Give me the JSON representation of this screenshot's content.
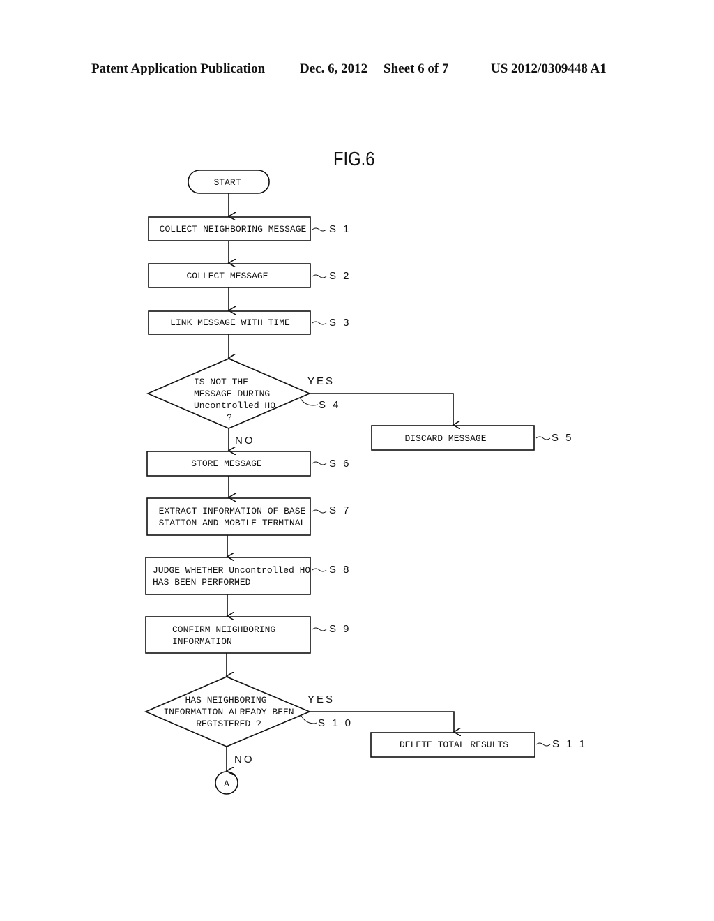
{
  "header": {
    "publication": "Patent Application Publication",
    "date": "Dec. 6, 2012",
    "sheet": "Sheet 6 of 7",
    "number": "US 2012/0309448 A1"
  },
  "figure_label": "FIG.6",
  "flowchart": {
    "start": "START",
    "connector": "A",
    "yes_label": "YES",
    "no_label": "NO",
    "steps": {
      "s1": {
        "id": "S1",
        "label": "S 1",
        "lines": [
          "COLLECT NEIGHBORING MESSAGE"
        ]
      },
      "s2": {
        "id": "S2",
        "label": "S 2",
        "lines": [
          "COLLECT MESSAGE"
        ]
      },
      "s3": {
        "id": "S3",
        "label": "S 3",
        "lines": [
          "LINK MESSAGE WITH TIME"
        ]
      },
      "s4": {
        "id": "S4",
        "label": "S 4",
        "lines": [
          "IS NOT THE",
          "MESSAGE DURING",
          "Uncontrolled HO",
          "?"
        ]
      },
      "s5": {
        "id": "S5",
        "label": "S 5",
        "lines": [
          "DISCARD MESSAGE"
        ]
      },
      "s6": {
        "id": "S6",
        "label": "S 6",
        "lines": [
          "STORE MESSAGE"
        ]
      },
      "s7": {
        "id": "S7",
        "label": "S 7",
        "lines": [
          "EXTRACT INFORMATION OF BASE",
          "STATION AND MOBILE TERMINAL"
        ]
      },
      "s8": {
        "id": "S8",
        "label": "S 8",
        "lines": [
          "JUDGE WHETHER Uncontrolled HO",
          "HAS BEEN PERFORMED"
        ]
      },
      "s9": {
        "id": "S9",
        "label": "S 9",
        "lines": [
          "CONFIRM NEIGHBORING",
          "INFORMATION"
        ]
      },
      "s10": {
        "id": "S10",
        "label": "S 1 0",
        "lines": [
          "HAS NEIGHBORING",
          "INFORMATION ALREADY BEEN",
          "REGISTERED ?"
        ]
      },
      "s11": {
        "id": "S11",
        "label": "S 1 1",
        "lines": [
          "DELETE TOTAL RESULTS"
        ]
      }
    }
  }
}
